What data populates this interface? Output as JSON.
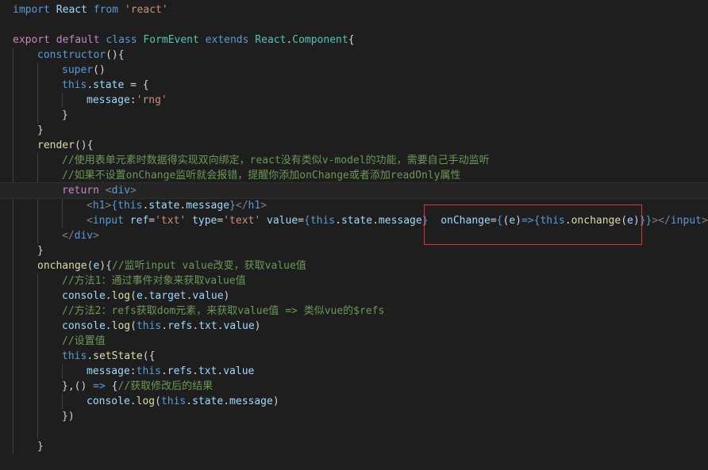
{
  "editor": {
    "lines": [
      {
        "indent": 0,
        "tokens": [
          [
            "kw",
            "import"
          ],
          [
            "pun",
            " "
          ],
          [
            "var",
            "React"
          ],
          [
            "pun",
            " "
          ],
          [
            "kw",
            "from"
          ],
          [
            "pun",
            " "
          ],
          [
            "str",
            "'react'"
          ]
        ]
      },
      {
        "indent": 0,
        "tokens": []
      },
      {
        "indent": 0,
        "tokens": [
          [
            "ctl",
            "export"
          ],
          [
            "pun",
            " "
          ],
          [
            "ctl",
            "default"
          ],
          [
            "pun",
            " "
          ],
          [
            "kw",
            "class"
          ],
          [
            "pun",
            " "
          ],
          [
            "cls",
            "FormEvent"
          ],
          [
            "pun",
            " "
          ],
          [
            "kw",
            "extends"
          ],
          [
            "pun",
            " "
          ],
          [
            "cls",
            "React"
          ],
          [
            "pun",
            "."
          ],
          [
            "cls",
            "Component"
          ],
          [
            "pun",
            "{"
          ]
        ]
      },
      {
        "indent": 1,
        "tokens": [
          [
            "kw",
            "constructor"
          ],
          [
            "pun",
            "(){"
          ]
        ]
      },
      {
        "indent": 2,
        "tokens": [
          [
            "kw",
            "super"
          ],
          [
            "pun",
            "()"
          ]
        ]
      },
      {
        "indent": 2,
        "tokens": [
          [
            "kw",
            "this"
          ],
          [
            "pun",
            "."
          ],
          [
            "var",
            "state"
          ],
          [
            "pun",
            " = {"
          ]
        ]
      },
      {
        "indent": 3,
        "tokens": [
          [
            "var",
            "message"
          ],
          [
            "pun",
            ":"
          ],
          [
            "str",
            "'rng'"
          ]
        ]
      },
      {
        "indent": 2,
        "tokens": [
          [
            "pun",
            "}"
          ]
        ]
      },
      {
        "indent": 1,
        "tokens": [
          [
            "pun",
            "}"
          ]
        ]
      },
      {
        "indent": 1,
        "tokens": [
          [
            "fn",
            "render"
          ],
          [
            "pun",
            "(){"
          ]
        ]
      },
      {
        "indent": 2,
        "tokens": [
          [
            "cmt",
            "//使用表单元素时数据得实现双向绑定，react没有类似v-model的功能，需要自己手动监听"
          ]
        ]
      },
      {
        "indent": 2,
        "tokens": [
          [
            "cmt",
            "//如果不设置onChange监听就会报错，提醒你添加onChange或者添加readOnly属性"
          ]
        ]
      },
      {
        "indent": 2,
        "current": true,
        "tokens": [
          [
            "ctl",
            "return"
          ],
          [
            "pun",
            " "
          ],
          [
            "brk",
            "<"
          ],
          [
            "tag",
            "div"
          ],
          [
            "brk",
            ">"
          ]
        ]
      },
      {
        "indent": 3,
        "tokens": [
          [
            "brk",
            "<"
          ],
          [
            "tag",
            "h1"
          ],
          [
            "brk",
            ">"
          ],
          [
            "kw",
            "{"
          ],
          [
            "kw",
            "this"
          ],
          [
            "pun",
            "."
          ],
          [
            "var",
            "state"
          ],
          [
            "pun",
            "."
          ],
          [
            "var",
            "message"
          ],
          [
            "kw",
            "}"
          ],
          [
            "brk",
            "</"
          ],
          [
            "tag",
            "h1"
          ],
          [
            "brk",
            ">"
          ]
        ]
      },
      {
        "indent": 3,
        "tokens": [
          [
            "brk",
            "<"
          ],
          [
            "tag",
            "input"
          ],
          [
            "pun",
            " "
          ],
          [
            "var",
            "ref"
          ],
          [
            "pun",
            "="
          ],
          [
            "str",
            "'txt'"
          ],
          [
            "pun",
            " "
          ],
          [
            "var",
            "type"
          ],
          [
            "pun",
            "="
          ],
          [
            "str",
            "'text'"
          ],
          [
            "pun",
            " "
          ],
          [
            "var",
            "value"
          ],
          [
            "pun",
            "="
          ],
          [
            "kw",
            "{"
          ],
          [
            "kw",
            "this"
          ],
          [
            "pun",
            "."
          ],
          [
            "var",
            "state"
          ],
          [
            "pun",
            "."
          ],
          [
            "var",
            "message"
          ],
          [
            "kw",
            "}"
          ],
          [
            "pun",
            "  "
          ],
          [
            "var",
            "onChange"
          ],
          [
            "pun",
            "="
          ],
          [
            "kw",
            "{"
          ],
          [
            "pun",
            "("
          ],
          [
            "var",
            "e"
          ],
          [
            "pun",
            ")"
          ],
          [
            "kw",
            "=>"
          ],
          [
            "kw",
            "{"
          ],
          [
            "kw",
            "this"
          ],
          [
            "pun",
            "."
          ],
          [
            "fn",
            "onchange"
          ],
          [
            "pun",
            "("
          ],
          [
            "var",
            "e"
          ],
          [
            "pun",
            ")"
          ],
          [
            "kw",
            "}"
          ],
          [
            "kw",
            "}"
          ],
          [
            "brk",
            "></"
          ],
          [
            "tag",
            "input"
          ],
          [
            "brk",
            ">"
          ]
        ]
      },
      {
        "indent": 2,
        "tokens": [
          [
            "brk",
            "</"
          ],
          [
            "tag",
            "div"
          ],
          [
            "brk",
            ">"
          ]
        ]
      },
      {
        "indent": 1,
        "tokens": [
          [
            "pun",
            "}"
          ]
        ]
      },
      {
        "indent": 1,
        "tokens": [
          [
            "fn",
            "onchange"
          ],
          [
            "pun",
            "("
          ],
          [
            "var",
            "e"
          ],
          [
            "pun",
            "){"
          ],
          [
            "cmt",
            "//监听input value改变，获取value值"
          ]
        ]
      },
      {
        "indent": 2,
        "tokens": [
          [
            "cmt",
            "//方法1：通过事件对象来获取value值"
          ]
        ]
      },
      {
        "indent": 2,
        "tokens": [
          [
            "var",
            "console"
          ],
          [
            "pun",
            "."
          ],
          [
            "fn",
            "log"
          ],
          [
            "pun",
            "("
          ],
          [
            "var",
            "e"
          ],
          [
            "pun",
            "."
          ],
          [
            "var",
            "target"
          ],
          [
            "pun",
            "."
          ],
          [
            "var",
            "value"
          ],
          [
            "pun",
            ")"
          ]
        ]
      },
      {
        "indent": 2,
        "tokens": [
          [
            "cmt",
            "//方法2：refs获取dom元素，来获取value值 => 类似vue的$refs"
          ]
        ]
      },
      {
        "indent": 2,
        "tokens": [
          [
            "var",
            "console"
          ],
          [
            "pun",
            "."
          ],
          [
            "fn",
            "log"
          ],
          [
            "pun",
            "("
          ],
          [
            "kw",
            "this"
          ],
          [
            "pun",
            "."
          ],
          [
            "var",
            "refs"
          ],
          [
            "pun",
            "."
          ],
          [
            "var",
            "txt"
          ],
          [
            "pun",
            "."
          ],
          [
            "var",
            "value"
          ],
          [
            "pun",
            ")"
          ]
        ]
      },
      {
        "indent": 2,
        "tokens": [
          [
            "cmt",
            "//设置值"
          ]
        ]
      },
      {
        "indent": 2,
        "tokens": [
          [
            "kw",
            "this"
          ],
          [
            "pun",
            "."
          ],
          [
            "fn",
            "setState"
          ],
          [
            "pun",
            "({"
          ]
        ]
      },
      {
        "indent": 3,
        "tokens": [
          [
            "var",
            "message"
          ],
          [
            "pun",
            ":"
          ],
          [
            "kw",
            "this"
          ],
          [
            "pun",
            "."
          ],
          [
            "var",
            "refs"
          ],
          [
            "pun",
            "."
          ],
          [
            "var",
            "txt"
          ],
          [
            "pun",
            "."
          ],
          [
            "var",
            "value"
          ]
        ]
      },
      {
        "indent": 2,
        "tokens": [
          [
            "pun",
            "},() "
          ],
          [
            "kw",
            "=>"
          ],
          [
            "pun",
            " {"
          ],
          [
            "cmt",
            "//获取修改后的结果"
          ]
        ]
      },
      {
        "indent": 3,
        "tokens": [
          [
            "var",
            "console"
          ],
          [
            "pun",
            "."
          ],
          [
            "fn",
            "log"
          ],
          [
            "pun",
            "("
          ],
          [
            "kw",
            "this"
          ],
          [
            "pun",
            "."
          ],
          [
            "var",
            "state"
          ],
          [
            "pun",
            "."
          ],
          [
            "var",
            "message"
          ],
          [
            "pun",
            ")"
          ]
        ]
      },
      {
        "indent": 2,
        "tokens": [
          [
            "pun",
            "})"
          ]
        ]
      },
      {
        "indent": 0,
        "tokens": []
      },
      {
        "indent": 1,
        "tokens": [
          [
            "pun",
            "}"
          ]
        ]
      }
    ]
  },
  "annotation": {
    "label": "highlight-box",
    "color": "#e0342a"
  }
}
